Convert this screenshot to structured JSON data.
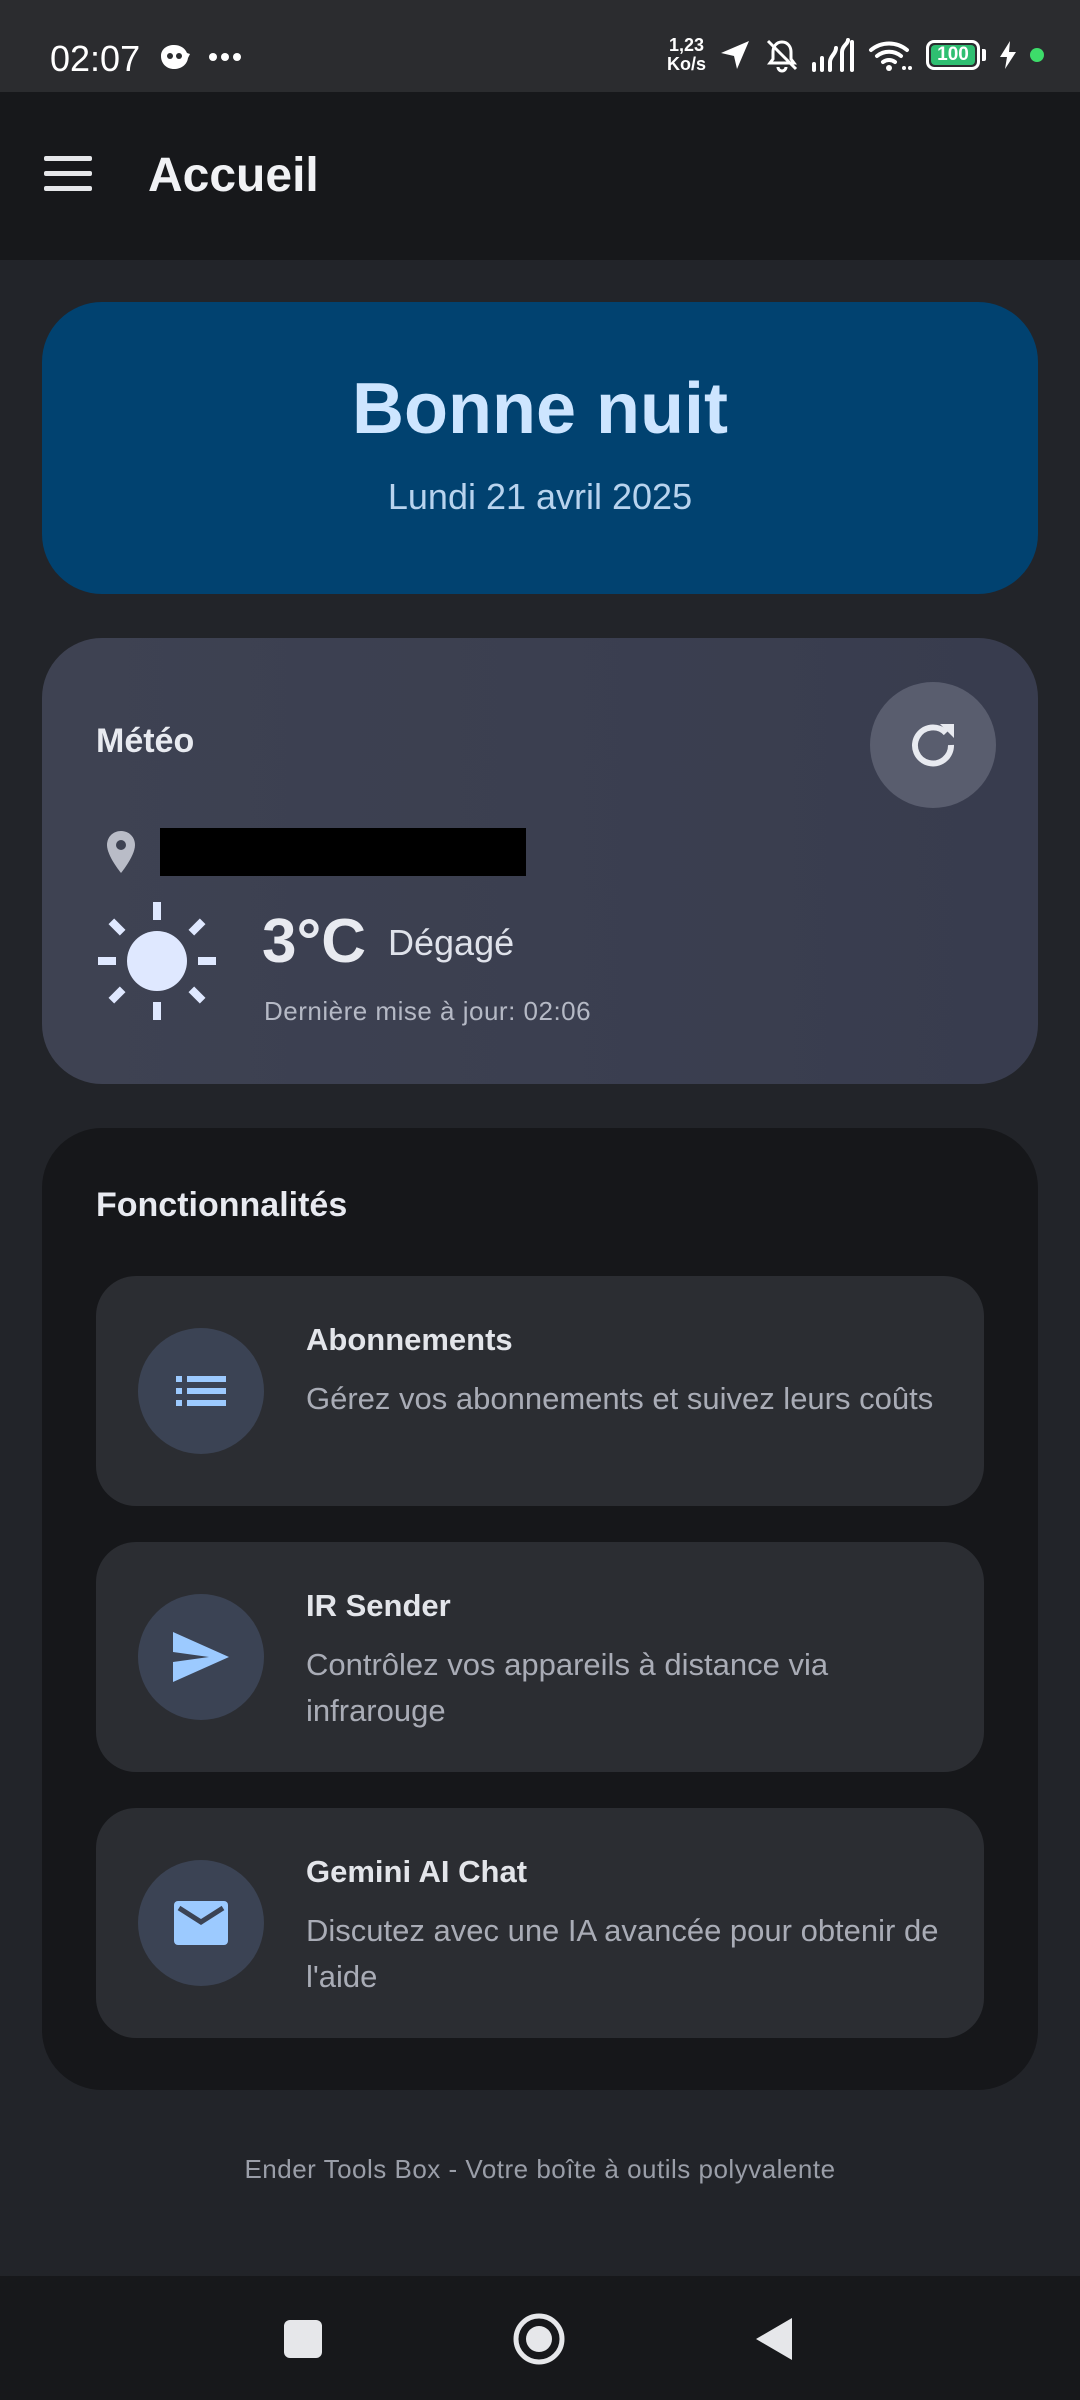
{
  "status_bar": {
    "time": "02:07",
    "net_speed_value": "1,23",
    "net_speed_unit": "Ko/s",
    "battery": "100",
    "icons": [
      "cat-app-icon",
      "more-icon",
      "location-arrow-icon",
      "bell-muted-icon",
      "signal-icon",
      "wifi-icon",
      "battery-icon",
      "charging-icon"
    ]
  },
  "app_bar": {
    "title": "Accueil"
  },
  "greeting": {
    "title": "Bonne nuit",
    "date": "Lundi 21 avril 2025"
  },
  "weather": {
    "title": "Météo",
    "temperature": "3°C",
    "condition": "Dégagé",
    "updated": "Dernière mise à jour: 02:06"
  },
  "features": {
    "title": "Fonctionnalités",
    "items": [
      {
        "name": "Abonnements",
        "description": "Gérez vos abonnements et suivez leurs coûts",
        "icon": "list-icon"
      },
      {
        "name": "IR Sender",
        "description": "Contrôlez vos appareils à distance via infrarouge",
        "icon": "send-icon"
      },
      {
        "name": "Gemini AI Chat",
        "description": "Discutez avec une IA avancée pour obtenir de l'aide",
        "icon": "mail-icon"
      }
    ]
  },
  "footer": "Ender Tools Box - Votre boîte à outils polyvalente",
  "colors": {
    "greeting_bg": "#014270",
    "accent_icon": "#9ccaff",
    "battery_green": "#2fbf71"
  }
}
